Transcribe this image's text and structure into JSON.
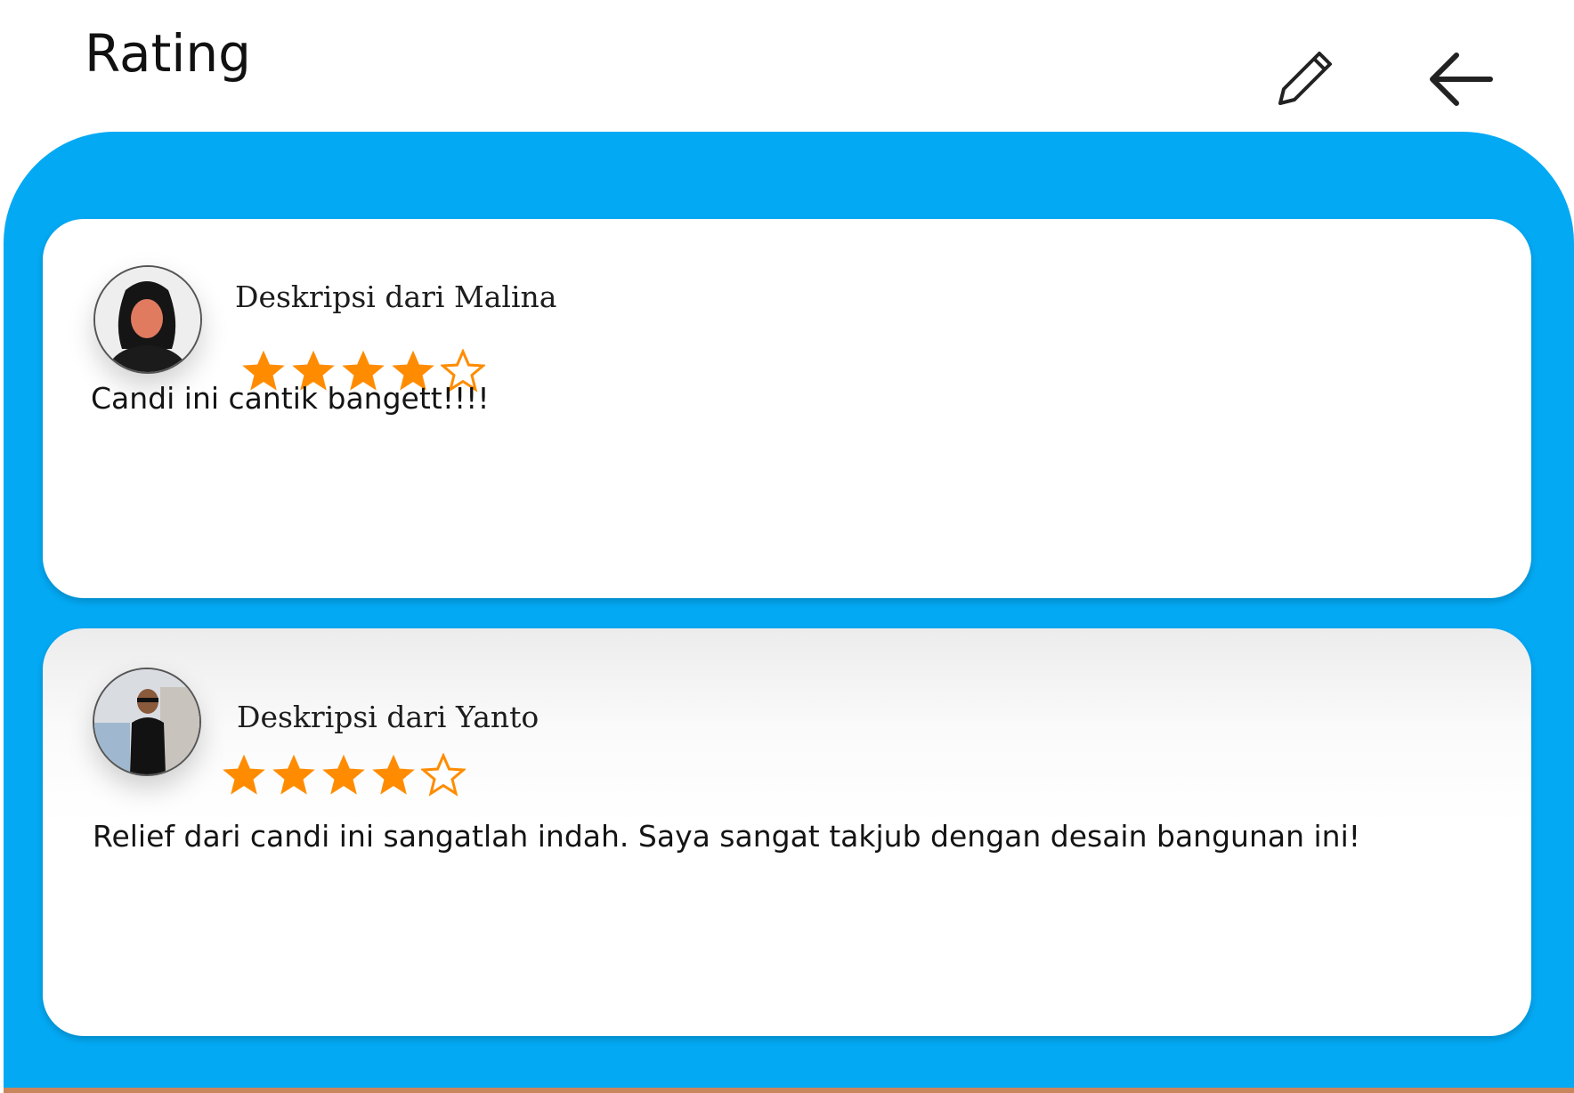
{
  "header": {
    "title": "Rating",
    "edit_icon": "pencil-icon",
    "back_icon": "arrow-left-icon"
  },
  "colors": {
    "panel": "#04a9f4",
    "star": "#ff8c00",
    "card": "#ffffff"
  },
  "reviews": [
    {
      "name": "Deskripsi dari Malina",
      "rating": 4,
      "max_rating": 5,
      "text": "Candi ini cantik bangett!!!!"
    },
    {
      "name": "Deskripsi dari Yanto",
      "rating": 4,
      "max_rating": 5,
      "text": "Relief dari candi ini sangatlah indah. Saya sangat takjub dengan desain bangunan ini!"
    }
  ]
}
